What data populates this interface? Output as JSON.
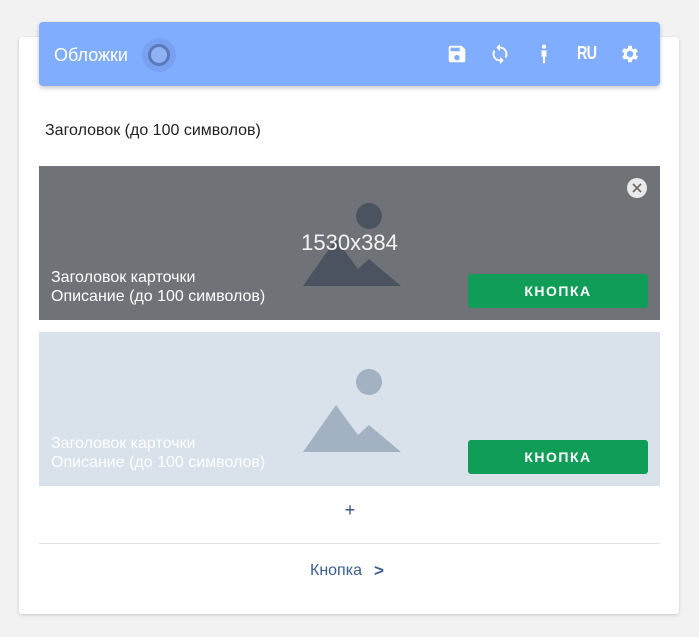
{
  "toolbar": {
    "title": "Обложки",
    "lang": "RU",
    "icons": [
      "save-icon",
      "sync-icon",
      "person-icon",
      "gear-icon"
    ]
  },
  "heading": "Заголовок (до 100 символов)",
  "slides": [
    {
      "size": "1530x384",
      "title": "Заголовок карточки",
      "description": "Описание (до 100 символов)",
      "button": "КНОПКА"
    },
    {
      "title": "Заголовок карточки",
      "description": "Описание (до 100 символов)",
      "button": "КНОПКА"
    }
  ],
  "add_label": "+",
  "footer_button": {
    "label": "Кнопка",
    "chevron": ">"
  },
  "colors": {
    "toolbar": "#80adfd",
    "button": "#109d58",
    "slide1_bg": "#6f7378",
    "slide2_bg": "#d9e2eb"
  }
}
